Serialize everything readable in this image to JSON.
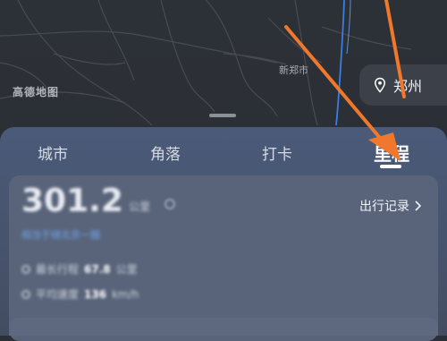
{
  "map": {
    "district_label": "新郑市",
    "watermark": "高德地图"
  },
  "location": {
    "city": "郑州",
    "icon": "location-pin-icon"
  },
  "tabs": [
    {
      "label": "城市",
      "active": false
    },
    {
      "label": "角落",
      "active": false
    },
    {
      "label": "打卡",
      "active": false
    },
    {
      "label": "里程",
      "active": true
    }
  ],
  "mileage_card": {
    "value": "301.2",
    "unit": "公里",
    "subtitle": "相当于绕北京一圈",
    "records_link": "出行记录",
    "records_chevron": "chevron-right-icon",
    "stats": [
      {
        "label": "最长行程",
        "value": "67.8",
        "unit": "公里"
      },
      {
        "label": "平均速度",
        "value": "136",
        "unit": "km/h"
      }
    ]
  },
  "colors": {
    "annotation_arrow": "#f0782c",
    "sheet": "#4a5a78",
    "route_blue": "#3b7de0"
  }
}
